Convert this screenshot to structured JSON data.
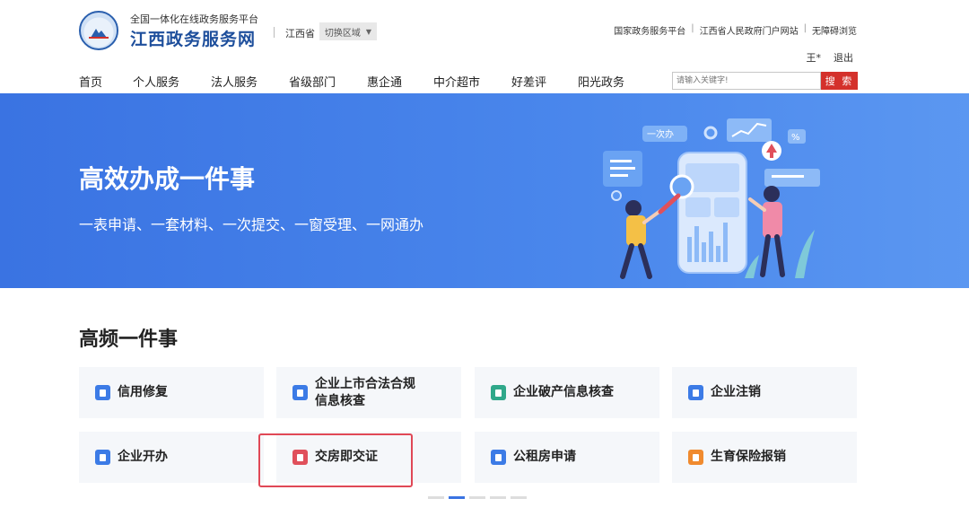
{
  "header": {
    "subtitle": "全国一体化在线政务服务平台",
    "title": "江西政务服务网",
    "province": "江西省",
    "region_switch": "切换区域",
    "top_links": [
      "国家政务服务平台",
      "江西省人民政府门户网站",
      "无障碍浏览"
    ],
    "user_name": "王*",
    "logout": "退出"
  },
  "nav": {
    "items": [
      "首页",
      "个人服务",
      "法人服务",
      "省级部门",
      "惠企通",
      "中介超市",
      "好差评",
      "阳光政务"
    ]
  },
  "search": {
    "placeholder": "请输入关键字!",
    "button": "搜 索"
  },
  "banner": {
    "title": "高效办成一件事",
    "subtitle": "一表申请、一套材料、一次提交、一窗受理、一网通办",
    "illus_tag": "一次办"
  },
  "section": {
    "title": "高频一件事",
    "cards": [
      {
        "lines": [
          "信用修复"
        ],
        "color": "#3c7be6"
      },
      {
        "lines": [
          "企业上市合法合规",
          "信息核查"
        ],
        "color": "#3c7be6"
      },
      {
        "lines": [
          "企业破产信息核查"
        ],
        "color": "#2fa88a"
      },
      {
        "lines": [
          "企业注销"
        ],
        "color": "#3c7be6"
      },
      {
        "lines": [
          "企业开办"
        ],
        "color": "#3c7be6"
      },
      {
        "lines": [
          "交房即交证"
        ],
        "color": "#e0505b"
      },
      {
        "lines": [
          "公租房申请"
        ],
        "color": "#3c7be6"
      },
      {
        "lines": [
          "生育保险报销"
        ],
        "color": "#f08a2e"
      }
    ]
  },
  "carousel": {
    "page_count": 5,
    "active_page": 2
  },
  "colors": {
    "brand_blue": "#1e4f9c",
    "banner_blue": "#3a73e2",
    "search_red": "#d4312b",
    "highlight_red": "#e04856"
  }
}
